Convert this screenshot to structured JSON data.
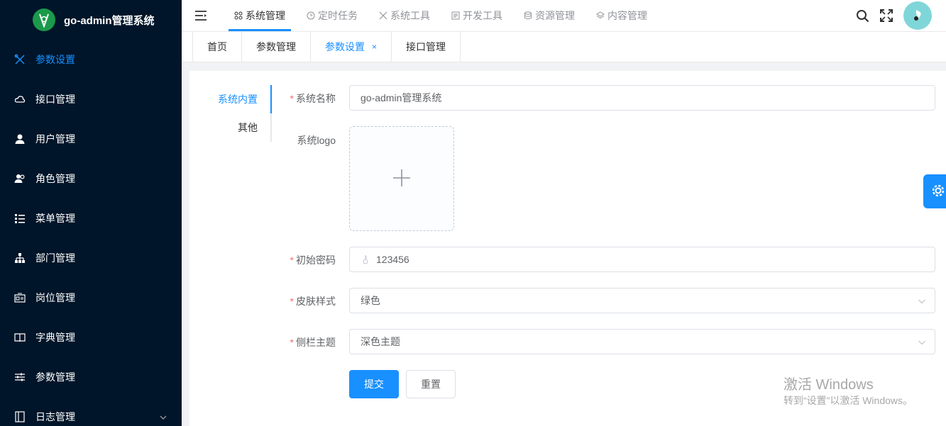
{
  "brand": {
    "title": "go-admin管理系统",
    "logo_icon": "leaf-logo-icon"
  },
  "sidebar": {
    "items": [
      {
        "label": "参数设置",
        "icon": "tools-icon",
        "active": true
      },
      {
        "label": "接口管理",
        "icon": "cloud-icon"
      },
      {
        "label": "用户管理",
        "icon": "user-icon"
      },
      {
        "label": "角色管理",
        "icon": "users-icon"
      },
      {
        "label": "菜单管理",
        "icon": "list-icon"
      },
      {
        "label": "部门管理",
        "icon": "tree-icon"
      },
      {
        "label": "岗位管理",
        "icon": "post-icon"
      },
      {
        "label": "字典管理",
        "icon": "book-icon"
      },
      {
        "label": "参数管理",
        "icon": "sliders-icon"
      },
      {
        "label": "日志管理",
        "icon": "log-icon"
      }
    ]
  },
  "topnav": {
    "items": [
      {
        "label": "系统管理",
        "active": true
      },
      {
        "label": "定时任务"
      },
      {
        "label": "系统工具"
      },
      {
        "label": "开发工具"
      },
      {
        "label": "资源管理"
      },
      {
        "label": "内容管理"
      }
    ]
  },
  "tabs": {
    "items": [
      {
        "label": "首页"
      },
      {
        "label": "参数管理"
      },
      {
        "label": "参数设置",
        "active": true,
        "close": "×"
      },
      {
        "label": "接口管理"
      }
    ]
  },
  "vtabs": {
    "items": [
      {
        "label": "系统内置",
        "active": true
      },
      {
        "label": "其他"
      }
    ]
  },
  "form": {
    "required_mark": "*",
    "system_name": {
      "label": "系统名称",
      "value": "go-admin管理系统"
    },
    "system_logo": {
      "label": "系统logo"
    },
    "init_password": {
      "label": "初始密码",
      "value": "123456"
    },
    "skin_style": {
      "label": "皮肤样式",
      "value": "绿色"
    },
    "sidebar_theme": {
      "label": "侧栏主题",
      "value": "深色主题"
    },
    "submit_label": "提交",
    "reset_label": "重置"
  },
  "watermark": {
    "title": "激活 Windows",
    "subtitle": "转到“设置”以激活 Windows。"
  },
  "colors": {
    "primary": "#1890ff",
    "sidebar_bg": "#001529",
    "required": "#f56c6c",
    "brand_green": "#1b9a4b"
  }
}
